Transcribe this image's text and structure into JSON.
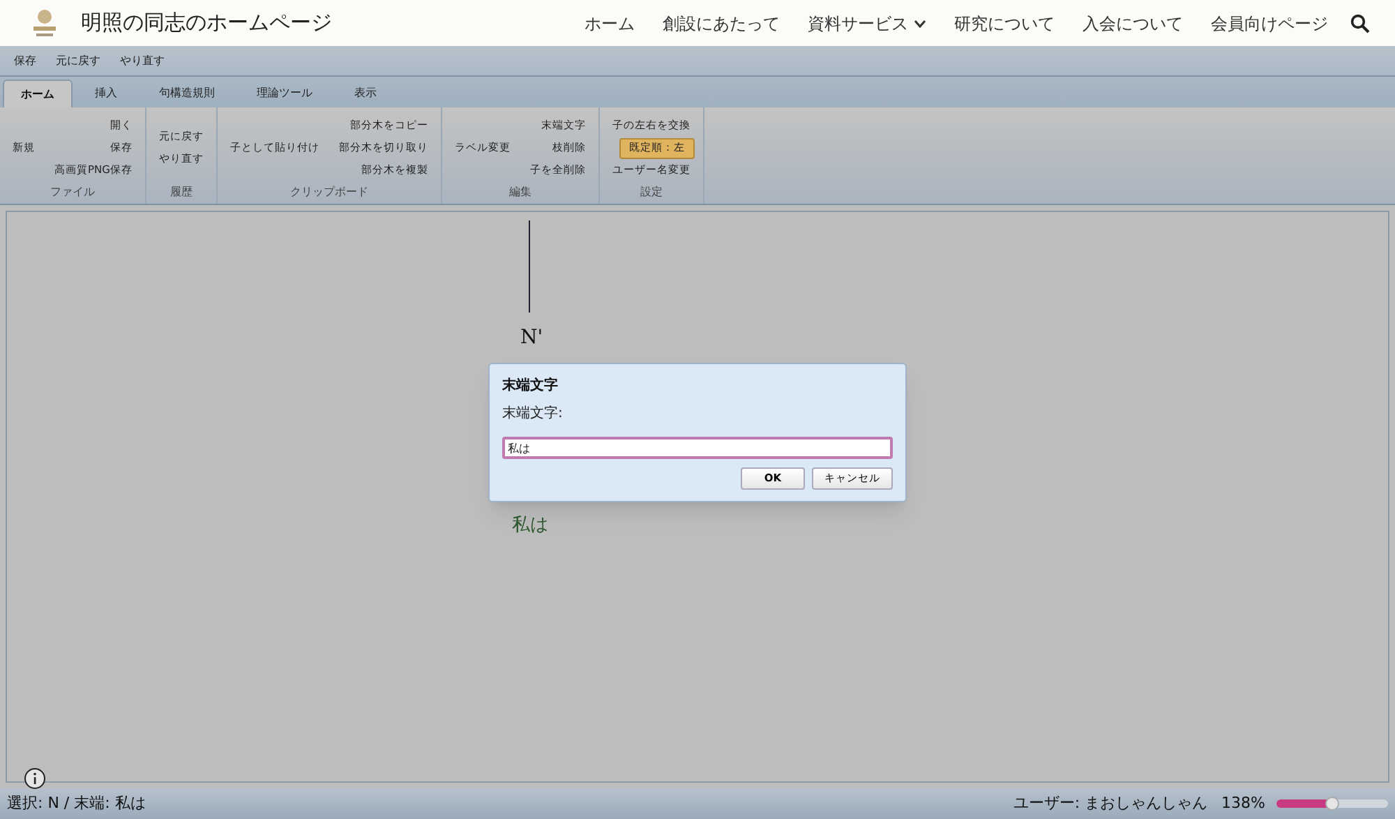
{
  "site": {
    "title": "明照の同志のホームページ",
    "nav": [
      {
        "label": "ホーム",
        "dropdown": false
      },
      {
        "label": "創設にあたって",
        "dropdown": false
      },
      {
        "label": "資料サービス",
        "dropdown": true
      },
      {
        "label": "研究について",
        "dropdown": false
      },
      {
        "label": "入会について",
        "dropdown": false
      },
      {
        "label": "会員向けページ",
        "dropdown": false
      }
    ]
  },
  "quick_toolbar": [
    "保存",
    "元に戻す",
    "やり直す"
  ],
  "tabs": [
    {
      "label": "ホーム",
      "selected": true
    },
    {
      "label": "挿入",
      "selected": false
    },
    {
      "label": "句構造規則",
      "selected": false
    },
    {
      "label": "理論ツール",
      "selected": false
    },
    {
      "label": "表示",
      "selected": false
    }
  ],
  "ribbon": [
    {
      "label": "ファイル",
      "columns": [
        [
          {
            "label": "新規",
            "on": false
          }
        ],
        [
          {
            "label": "開く",
            "on": false
          },
          {
            "label": "保存",
            "on": false
          },
          {
            "label": "高画質PNG保存",
            "on": false
          }
        ]
      ]
    },
    {
      "label": "履歴",
      "columns": [
        [
          {
            "label": "元に戻す",
            "on": false
          },
          {
            "label": "やり直す",
            "on": false
          }
        ]
      ]
    },
    {
      "label": "クリップボード",
      "columns": [
        [
          {
            "label": "子として貼り付け",
            "on": false
          }
        ],
        [
          {
            "label": "部分木をコピー",
            "on": false
          },
          {
            "label": "部分木を切り取り",
            "on": false
          },
          {
            "label": "部分木を複製",
            "on": false
          }
        ]
      ]
    },
    {
      "label": "編集",
      "columns": [
        [
          {
            "label": "ラベル変更",
            "on": false
          }
        ],
        [
          {
            "label": "末端文字",
            "on": false
          },
          {
            "label": "枝削除",
            "on": false
          },
          {
            "label": "子を全削除",
            "on": false
          }
        ]
      ]
    },
    {
      "label": "設定",
      "columns": [
        [
          {
            "label": "子の左右を交換",
            "on": false
          },
          {
            "label": "既定順：左",
            "on": true
          },
          {
            "label": "ユーザー名変更",
            "on": false
          }
        ]
      ]
    }
  ],
  "tree": {
    "node_label": "N'",
    "leaf": "私は"
  },
  "dialog": {
    "title": "末端文字",
    "prompt": "末端文字:",
    "value": "私は",
    "buttons": [
      "OK",
      "キャンセル"
    ]
  },
  "status_bar": {
    "selection": "選択: N / 末端: 私は",
    "user": "ユーザー: まおしゃんしゃん",
    "zoom": "138%",
    "level": 0.5
  }
}
